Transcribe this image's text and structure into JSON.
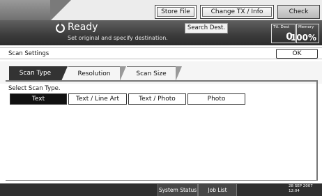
{
  "top_buttons": {
    "store_file": "Store File",
    "change_tx": "Change TX / Info",
    "check_modes": "Check Modes"
  },
  "status": {
    "title": "Ready",
    "subtitle": "Set original and specify destination.",
    "search_dest": "Search Dest."
  },
  "counters": {
    "ttl_dest_label": "Ttl. Dest",
    "ttl_dest_value": "0",
    "memory_label": "Memory",
    "memory_value": "100%"
  },
  "scan_settings": {
    "title": "Scan Settings",
    "ok": "OK"
  },
  "tabs": [
    {
      "label": "Scan Type",
      "active": true
    },
    {
      "label": "Resolution",
      "active": false
    },
    {
      "label": "Scan Size",
      "active": false
    }
  ],
  "select_label": "Select Scan Type.",
  "scan_types": [
    {
      "label": "Text",
      "selected": true
    },
    {
      "label": "Text / Line Art",
      "selected": false
    },
    {
      "label": "Text / Photo",
      "selected": false
    },
    {
      "label": "Photo",
      "selected": false
    }
  ],
  "bottom": {
    "system_status": "System Status",
    "job_list": "Job List",
    "date": "28 SEP  2007",
    "time": "12:04"
  }
}
